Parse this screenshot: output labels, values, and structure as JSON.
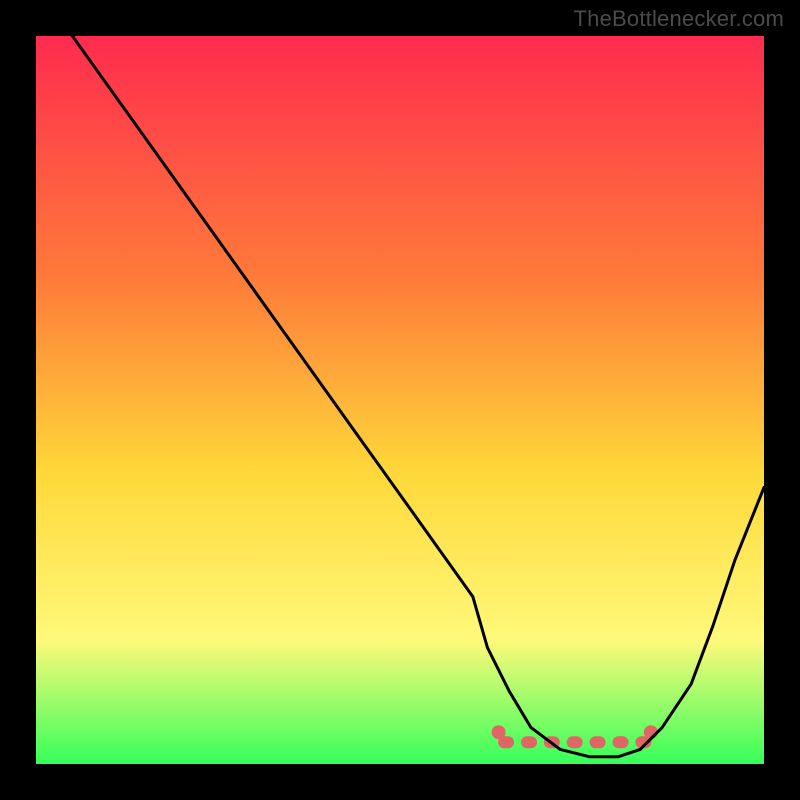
{
  "watermark": "TheBottlenecker.com",
  "colors": {
    "top": "#ff2b4e",
    "upper_mid": "#ff7a3a",
    "mid": "#ffd83a",
    "lower": "#fff97a",
    "bottom": "#35ff5a",
    "curve": "#000000",
    "highlight": "#e06666",
    "frame": "#000000"
  },
  "chart_data": {
    "type": "line",
    "title": "",
    "xlabel": "",
    "ylabel": "",
    "xlim": [
      0,
      100
    ],
    "ylim": [
      0,
      100
    ],
    "series": [
      {
        "name": "bottleneck-curve",
        "x": [
          5,
          10,
          15,
          20,
          25,
          30,
          35,
          40,
          45,
          50,
          55,
          60,
          62,
          65,
          68,
          72,
          76,
          80,
          83,
          86,
          90,
          93,
          96,
          100
        ],
        "values": [
          100,
          93,
          86,
          79,
          72,
          65,
          58,
          51,
          44,
          37,
          30,
          23,
          16,
          10,
          5,
          2,
          1,
          1,
          2,
          5,
          11,
          19,
          28,
          38
        ]
      }
    ],
    "annotations": [
      {
        "name": "valley-highlight-band",
        "x_range": [
          63,
          85
        ],
        "y": 3,
        "color": "#e06666"
      }
    ],
    "grid": false,
    "legend": false
  }
}
